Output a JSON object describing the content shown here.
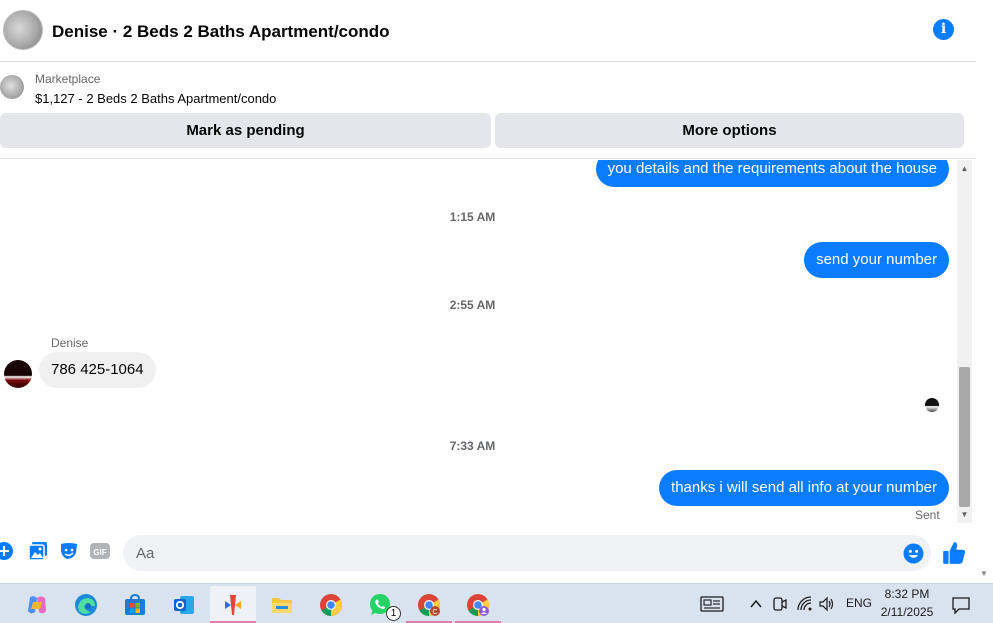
{
  "header": {
    "title": "Denise · 2 Beds 2 Baths Apartment/condo",
    "info_label": "i"
  },
  "listing": {
    "kicker": "Marketplace",
    "product": "$1,127 - 2 Beds 2 Baths Apartment/condo",
    "pending_label": "Mark as pending",
    "more_label": "More options"
  },
  "messages": {
    "out_1": "you details and the requirements about the house",
    "time_1": "1:15 AM",
    "out_2": "send your number",
    "time_2": "2:55 AM",
    "sender": "Denise",
    "in_1": "786 425-1064",
    "time_3": "7:33 AM",
    "out_3": "thanks i will send all info at your number",
    "sent_status": "Sent"
  },
  "composer": {
    "placeholder": "Aa",
    "gif_label": "GIF"
  },
  "taskbar": {
    "whatsapp_badge": "1",
    "lang": "ENG",
    "time": "8:32 PM",
    "date": "2/11/2025"
  },
  "colors": {
    "messenger_blue": "#0a7cff",
    "incoming_bubble": "#f0f0f0",
    "button_gray": "#e4e6eb",
    "taskbar_bg": "#d9e2ef"
  }
}
